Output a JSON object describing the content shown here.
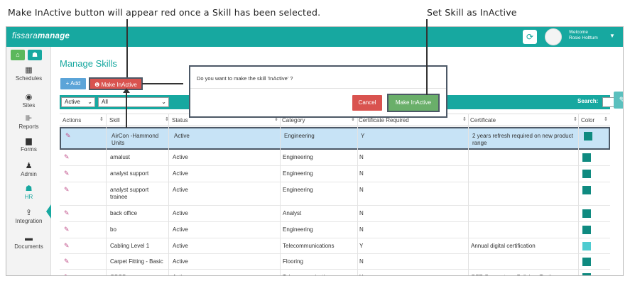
{
  "annotations": {
    "left": "Make InActive button will appear red once a Skill has been selected.",
    "right": "Set Skill as InActive"
  },
  "app": {
    "logo_light": "fissara",
    "logo_bold": "manage",
    "welcome": "Welcome",
    "user": "Rosie Holttum"
  },
  "sidebar": {
    "items": [
      {
        "label": "Schedules",
        "icon": "calendar-icon",
        "glyph": "▦"
      },
      {
        "label": "Sites",
        "icon": "location-icon",
        "glyph": "◉"
      },
      {
        "label": "Reports",
        "icon": "bar-chart-icon",
        "glyph": "⊪"
      },
      {
        "label": "Forms",
        "icon": "file-icon",
        "glyph": "▆"
      },
      {
        "label": "Admin",
        "icon": "user-icon",
        "glyph": "♟"
      },
      {
        "label": "HR",
        "icon": "users-icon",
        "glyph": "☗"
      },
      {
        "label": "Integration",
        "icon": "upload-icon",
        "glyph": "⇪"
      },
      {
        "label": "Documents",
        "icon": "folder-icon",
        "glyph": "▬"
      }
    ],
    "collapse_glyph": "«"
  },
  "page": {
    "title": "Manage Skills",
    "add_label": "+ Add",
    "make_inactive_label": "Make InActive"
  },
  "filters": {
    "status": "Active",
    "category": "All",
    "search_label": "Search:"
  },
  "table": {
    "columns": [
      "Actions",
      "Skill",
      "Status",
      "Category",
      "Certificate Required",
      "Certificate",
      "Color"
    ],
    "rows": [
      {
        "skill": "AirCon -Hammond Units",
        "status": "Active",
        "category": "Engineering",
        "cert_required": "Y",
        "certificate": "2 years refresh required on new product range",
        "color": "#0f8a80"
      },
      {
        "skill": "amalust",
        "status": "Active",
        "category": "Engineering",
        "cert_required": "N",
        "certificate": "",
        "color": "#0f8a80"
      },
      {
        "skill": "analyst support",
        "status": "Active",
        "category": "Engineering",
        "cert_required": "N",
        "certificate": "",
        "color": "#0f8a80"
      },
      {
        "skill": "analyst support trainee",
        "status": "Active",
        "category": "Engineering",
        "cert_required": "N",
        "certificate": "",
        "color": "#0f8a80"
      },
      {
        "skill": "back office",
        "status": "Active",
        "category": "Analyst",
        "cert_required": "N",
        "certificate": "",
        "color": "#0f8a80"
      },
      {
        "skill": "bo",
        "status": "Active",
        "category": "Engineering",
        "cert_required": "N",
        "certificate": "",
        "color": "#0f8a80"
      },
      {
        "skill": "Cabling Level 1",
        "status": "Active",
        "category": "Telecommunications",
        "cert_required": "Y",
        "certificate": "Annual digital certification",
        "color": "#4ecbd0"
      },
      {
        "skill": "Carpet Fitting - Basic",
        "status": "Active",
        "category": "Flooring",
        "cert_required": "N",
        "certificate": "",
        "color": "#0f8a80"
      },
      {
        "skill": "CSCS",
        "status": "Active",
        "category": "Telecommunications",
        "cert_required": "Y",
        "certificate": "OSP Connectors, Splicing, Testing",
        "color": "#0f8a80"
      }
    ]
  },
  "dialog": {
    "question": "Do you want to make the skill 'InActive' ?",
    "cancel_label": "Cancel",
    "confirm_label": "Make InActive"
  },
  "colors": {
    "brand": "#17a8a0",
    "danger": "#d9534f",
    "success": "#6aaf6a",
    "selected_row": "#c7e3f6"
  }
}
